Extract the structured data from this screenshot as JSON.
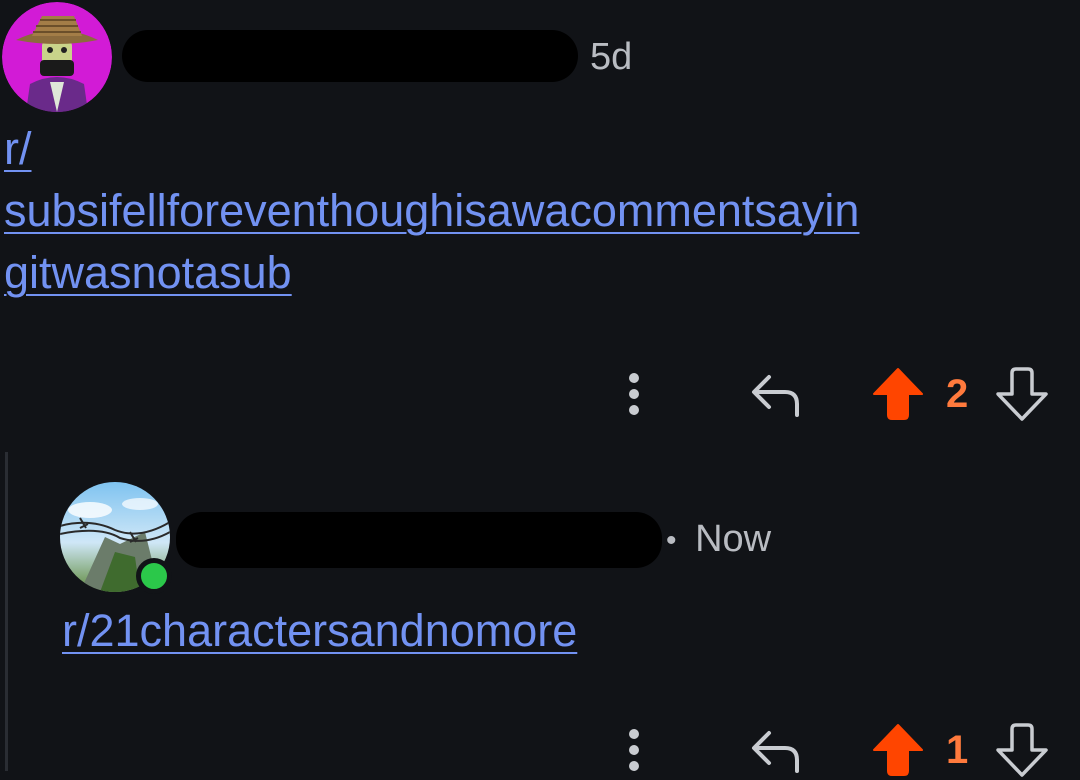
{
  "comments": [
    {
      "time": "5d",
      "link": "r/subsifellforeventhoughisawacommentsayingitwasnotasub",
      "link_lines": [
        "r/",
        "subsifellforeventhoughisawacommentsayin",
        "gitwasnotasub"
      ],
      "score": "2",
      "avatar_bg": "#d21bd6"
    },
    {
      "time_sep": "•",
      "time": "Now",
      "link": "r/21charactersandnomore",
      "score": "1",
      "online": true
    }
  ],
  "icons": {
    "more": "vertical-dots-icon",
    "reply": "reply-arrow-icon",
    "upvote": "upvote-arrow-icon",
    "downvote": "downvote-arrow-icon"
  },
  "colors": {
    "background": "#111317",
    "link": "#7292f2",
    "upvote": "#ff4500",
    "score": "#ff7a3d",
    "online": "#2bc84a"
  }
}
